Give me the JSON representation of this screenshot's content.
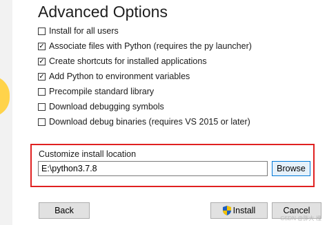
{
  "title": "Advanced Options",
  "options": [
    {
      "label": "Install for all users",
      "checked": false
    },
    {
      "label": "Associate files with Python (requires the py launcher)",
      "checked": true
    },
    {
      "label": "Create shortcuts for installed applications",
      "checked": true
    },
    {
      "label": "Add Python to environment variables",
      "checked": true
    },
    {
      "label": "Precompile standard library",
      "checked": false
    },
    {
      "label": "Download debugging symbols",
      "checked": false
    },
    {
      "label": "Download debug binaries (requires VS 2015 or later)",
      "checked": false
    }
  ],
  "location": {
    "label": "Customize install location",
    "value": "E:\\python3.7.8",
    "browse_label": "Browse"
  },
  "buttons": {
    "back": "Back",
    "install": "Install",
    "cancel": "Cancel"
  },
  "watermark": "CSDN @胖大·橙",
  "colors": {
    "highlight_border": "#e02020",
    "accent": "#0078d7"
  },
  "icons": {
    "install": "shield-icon"
  }
}
